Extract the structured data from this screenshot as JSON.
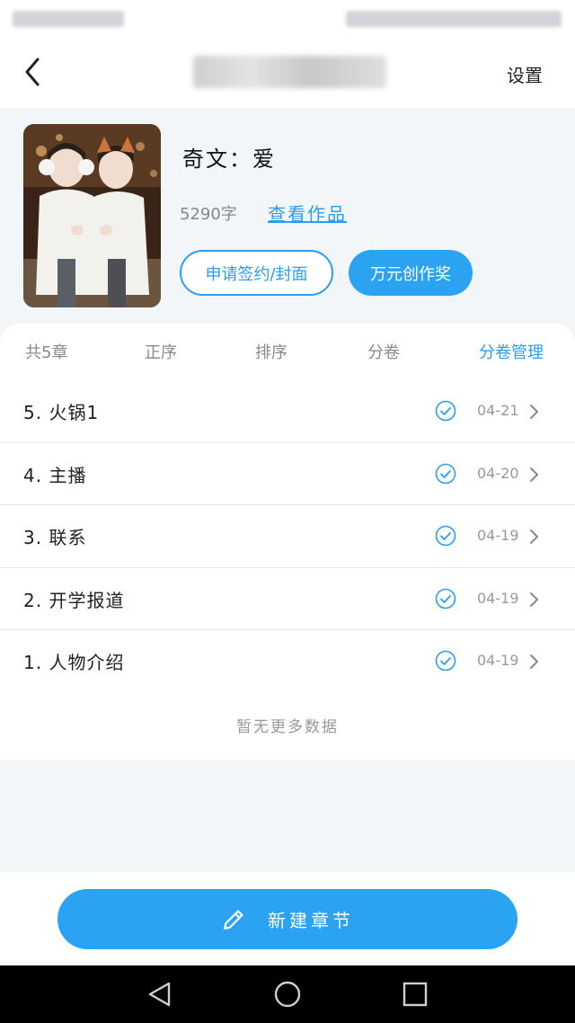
{
  "nav": {
    "settings_label": "设置"
  },
  "book": {
    "title": "奇文：爱",
    "word_count": "5290字",
    "view_works_label": "查看作品",
    "apply_label": "申请签约/封面",
    "award_label": "万元创作奖"
  },
  "tabs": [
    {
      "label": "共5章",
      "active": false
    },
    {
      "label": "正序",
      "active": false
    },
    {
      "label": "排序",
      "active": false
    },
    {
      "label": "分卷",
      "active": false
    },
    {
      "label": "分卷管理",
      "active": true
    }
  ],
  "chapters": [
    {
      "title": "5. 火锅1",
      "date": "04-21",
      "published": true
    },
    {
      "title": "4. 主播",
      "date": "04-20",
      "published": true
    },
    {
      "title": "3. 联系",
      "date": "04-19",
      "published": true
    },
    {
      "title": "2. 开学报道",
      "date": "04-19",
      "published": true
    },
    {
      "title": "1. 人物介绍",
      "date": "04-19",
      "published": true
    }
  ],
  "no_more_text": "暂无更多数据",
  "new_chapter_label": "新建章节",
  "colors": {
    "accent": "#2aa3f2",
    "background": "#f2f6f9"
  }
}
